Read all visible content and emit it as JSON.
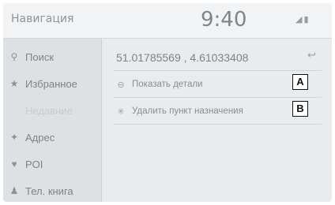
{
  "header": {
    "title": "Навигация",
    "clock": "9:40",
    "status_icons": "signal-icon, battery-icon"
  },
  "sidebar": {
    "items": [
      {
        "label": "Поиск",
        "icon": "search-icon",
        "enabled": true
      },
      {
        "label": "Избранное",
        "icon": "star-icon",
        "enabled": true
      },
      {
        "label": "Недавние",
        "icon": "clock-icon",
        "enabled": false
      },
      {
        "label": "Адрес",
        "icon": "address-icon",
        "enabled": true
      },
      {
        "label": "POI",
        "icon": "pin-icon",
        "enabled": true
      },
      {
        "label": "Тел. книга",
        "icon": "contacts-icon",
        "enabled": true
      }
    ]
  },
  "destination": {
    "coordinates": "51.01785569 , 4.61033408",
    "back_icon": "back-icon"
  },
  "actions": [
    {
      "label": "Показать детали",
      "icon": "info-icon",
      "callout": "A"
    },
    {
      "label": "Удалить пункт назначения",
      "icon": "delete-icon",
      "callout": "B"
    }
  ]
}
